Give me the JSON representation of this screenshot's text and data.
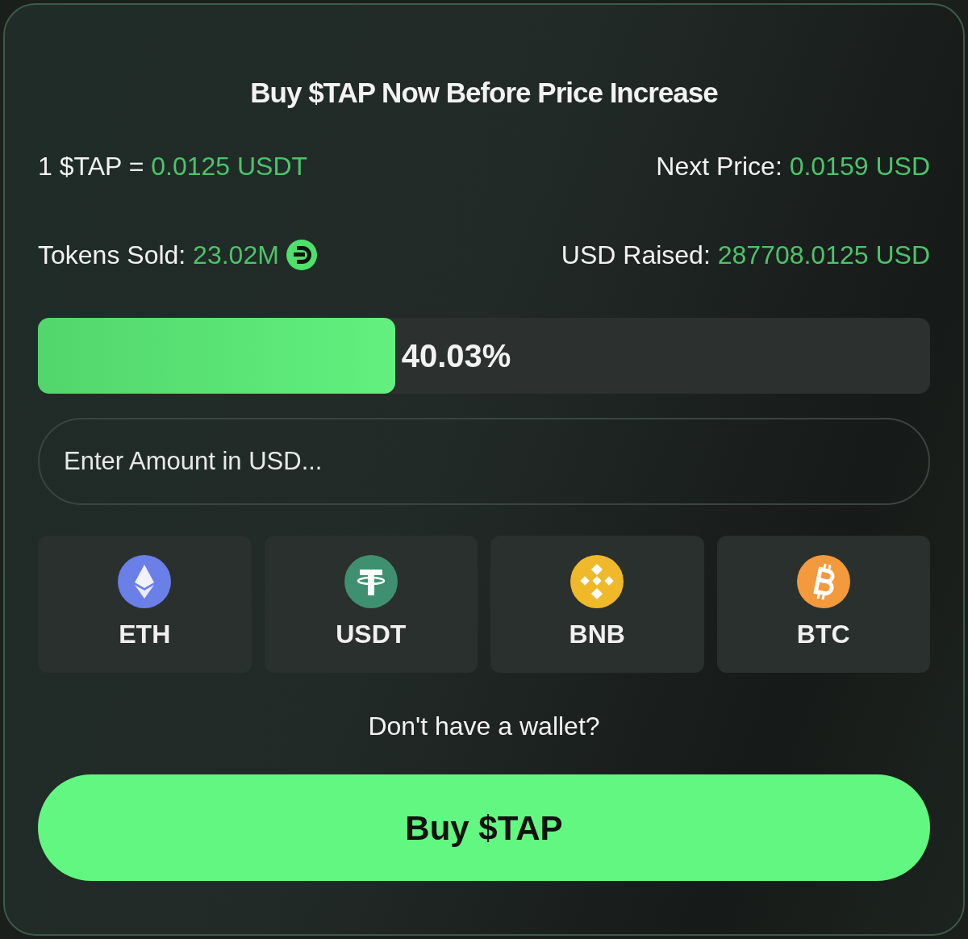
{
  "title": "Buy $TAP Now Before Price Increase",
  "price": {
    "label": "1 $TAP = ",
    "value": "0.0125 USDT"
  },
  "next_price": {
    "label": "Next Price: ",
    "value": "0.0159 USD"
  },
  "tokens_sold": {
    "label": "Tokens Sold: ",
    "value": "23.02M"
  },
  "usd_raised": {
    "label": "USD Raised: ",
    "value": "287708.0125 USD"
  },
  "progress": {
    "level": 0.4003,
    "reading": "40.03%"
  },
  "amount_field": {
    "placeholder": "Enter Amount in USD..."
  },
  "currencies": [
    {
      "kind": "eth",
      "label": "ETH",
      "color": "#6b7fe8"
    },
    {
      "kind": "usdt",
      "label": "USDT",
      "color": "#3f9070"
    },
    {
      "kind": "bnb",
      "label": "BNB",
      "color": "#f0b92a"
    },
    {
      "kind": "btc",
      "label": "BTC",
      "color": "#f29a3c"
    }
  ],
  "wallet_link": "Don't have a wallet?",
  "buy_button": "Buy $TAP"
}
